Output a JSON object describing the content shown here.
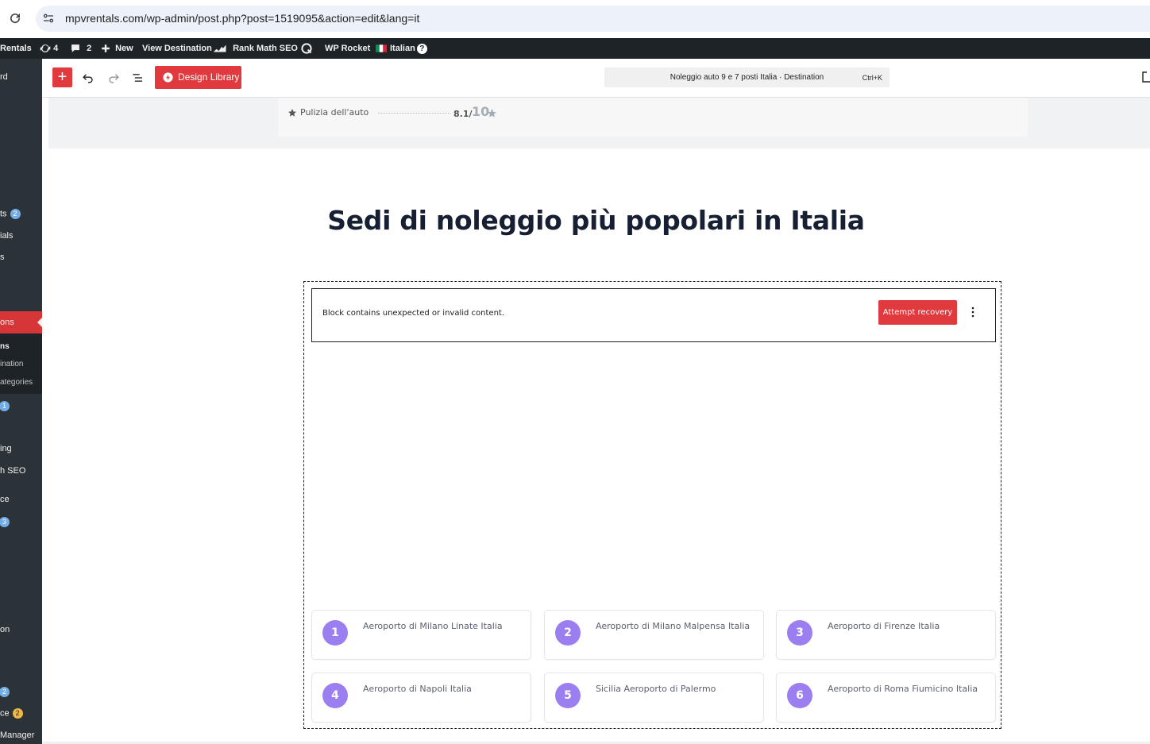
{
  "browser": {
    "url": "mpvrentals.com/wp-admin/post.php?post=1519095&action=edit&lang=it"
  },
  "admin_bar": {
    "site_name": "Rentals",
    "updates_count": "4",
    "comments_count": "2",
    "new_label": "New",
    "view_label": "View Destination",
    "rankmath_label": "Rank Math SEO",
    "rocket_label": "WP Rocket",
    "language_label": "Italian"
  },
  "sidebar": {
    "items": [
      {
        "label": "rd"
      },
      {
        "label": "ts",
        "badge": "2"
      },
      {
        "label": "ials"
      },
      {
        "label": "s"
      },
      {
        "label": "ons"
      },
      {
        "label": "ns"
      },
      {
        "label": "ination"
      },
      {
        "label": "ategories"
      },
      {
        "label": "",
        "badge": "1"
      },
      {
        "label": "ing"
      },
      {
        "label": "h SEO"
      },
      {
        "label": "ce"
      },
      {
        "label": "",
        "badge": "3"
      },
      {
        "label": "on"
      },
      {
        "label": "",
        "badge": "2"
      },
      {
        "label": "ce",
        "badge": "2"
      },
      {
        "label": "Manager"
      }
    ]
  },
  "toolbar": {
    "design_library_label": "Design Library",
    "document_title": "Noleggio auto 9 e 7 posti Italia · Destination",
    "shortcut": "Ctrl+K"
  },
  "rating": {
    "label": "Pulizia dell'auto",
    "score": "8.1/",
    "max": "10"
  },
  "section": {
    "heading": "Sedi di noleggio più popolari in Italia"
  },
  "block_warning": {
    "message": "Block contains unexpected or invalid content.",
    "recovery_label": "Attempt recovery"
  },
  "locations": [
    {
      "number": "1",
      "name": "Aeroporto di Milano Linate Italia"
    },
    {
      "number": "2",
      "name": "Aeroporto di Milano Malpensa Italia"
    },
    {
      "number": "3",
      "name": "Aeroporto di Firenze Italia"
    },
    {
      "number": "4",
      "name": "Aeroporto di Napoli Italia"
    },
    {
      "number": "5",
      "name": "Sicilia Aeroporto di Palermo"
    },
    {
      "number": "6",
      "name": "Aeroporto di Roma Fiumicino Italia"
    }
  ],
  "colors": {
    "wp_red": "#e0393e",
    "admin_bar": "#1d2327",
    "sidebar": "#2c3338",
    "number_badge": "#9b7ff0",
    "heading": "#172033"
  }
}
